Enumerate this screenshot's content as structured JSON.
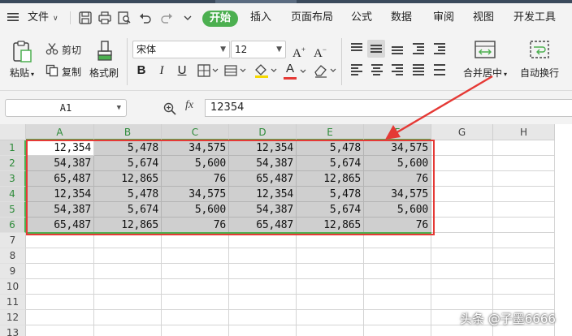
{
  "menubar": {
    "file_label": "文件",
    "tabs": [
      "开始",
      "插入",
      "页面布局",
      "公式",
      "数据",
      "审阅",
      "视图",
      "开发工具"
    ]
  },
  "ribbon": {
    "paste_label": "粘贴",
    "cut_label": "剪切",
    "copy_label": "复制",
    "format_painter_label": "格式刷",
    "font_name": "宋体",
    "font_size": "12",
    "bold": "B",
    "italic": "I",
    "underline": "U",
    "font_color_glyph": "A",
    "grow_glyph": "A",
    "shrink_glyph": "A",
    "merge_label": "合并居中",
    "wrap_label": "自动换行"
  },
  "formula_bar": {
    "name_box": "A1",
    "fx_label": "fx",
    "value": "12354"
  },
  "sheet": {
    "columns": [
      "A",
      "B",
      "C",
      "D",
      "E",
      "F",
      "G",
      "H"
    ],
    "rows": [
      "1",
      "2",
      "3",
      "4",
      "5",
      "6",
      "7",
      "8",
      "9",
      "10",
      "11",
      "12",
      "13"
    ],
    "data": [
      [
        "12,354",
        "5,478",
        "34,575",
        "12,354",
        "5,478",
        "34,575"
      ],
      [
        "54,387",
        "5,674",
        "5,600",
        "54,387",
        "5,674",
        "5,600"
      ],
      [
        "65,487",
        "12,865",
        "76",
        "65,487",
        "12,865",
        "76"
      ],
      [
        "12,354",
        "5,478",
        "34,575",
        "12,354",
        "5,478",
        "34,575"
      ],
      [
        "54,387",
        "5,674",
        "5,600",
        "54,387",
        "5,674",
        "5,600"
      ],
      [
        "65,487",
        "12,865",
        "76",
        "65,487",
        "12,865",
        "76"
      ]
    ]
  },
  "colors": {
    "accent_green": "#4caf50",
    "annotation_red": "#e53935",
    "selection_fill": "#cfcfcf"
  },
  "watermark": "头条 @子墨6666"
}
